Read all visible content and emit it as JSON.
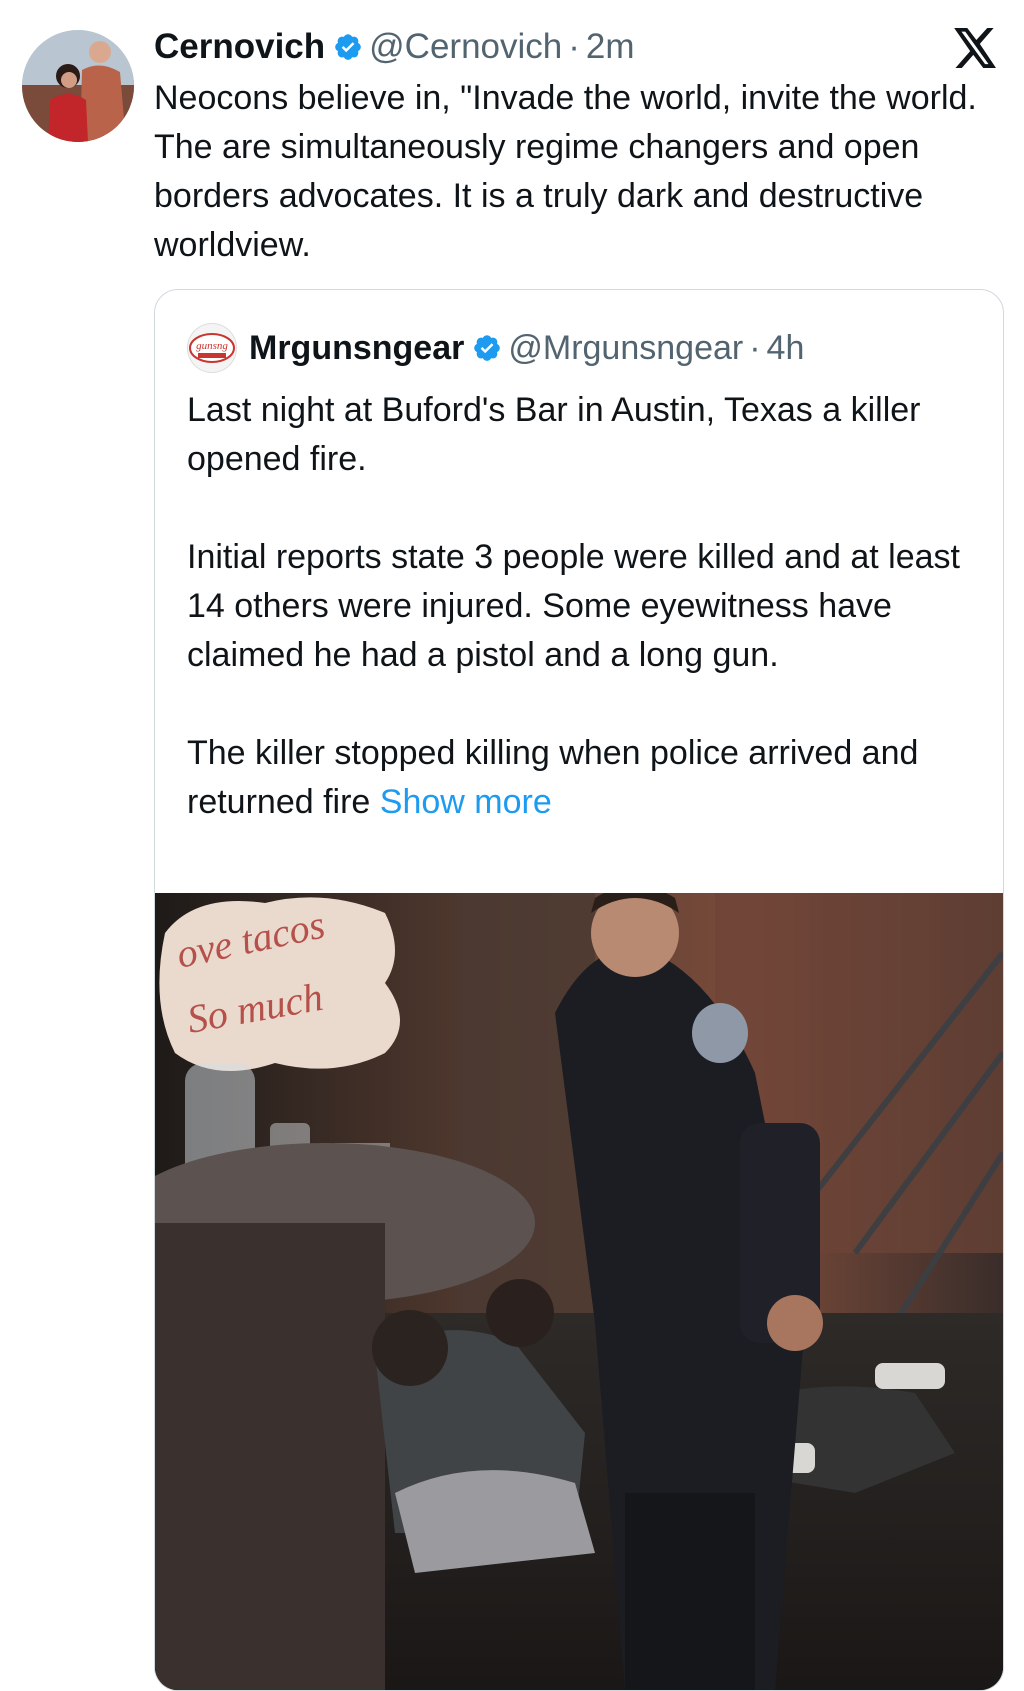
{
  "tweet": {
    "author_name": "Cernovich",
    "author_handle": "@Cernovich",
    "time": "2m",
    "separator": "·",
    "text": "Neocons believe in, \"Invade the world, invite the world. The are simultaneously regime changers and open borders advocates. It is a truly dark and destructive worldview."
  },
  "quoted_tweet": {
    "author_name": "Mrgunsngear",
    "author_handle": "@Mrgunsngear",
    "time": "4h",
    "separator": "·",
    "avatar_text": "gunsng",
    "paragraphs": [
      "Last night at Buford's Bar in Austin, Texas a killer opened fire.",
      "Initial reports state 3 people were killed and at least 14 others were injured.    Some eyewitness have claimed he had a pistol and a long gun.",
      "The killer stopped killing when police arrived and returned fire"
    ],
    "show_more_label": "Show more",
    "media": {
      "sign_text_1": "ove tacos",
      "sign_text_2": "So much"
    }
  },
  "colors": {
    "link": "#1d9bf0",
    "verified": "#1d9bf0",
    "secondary_text": "#536471",
    "border": "#cfd9de"
  },
  "icons": [
    "verified-badge-icon",
    "x-logo-icon"
  ]
}
